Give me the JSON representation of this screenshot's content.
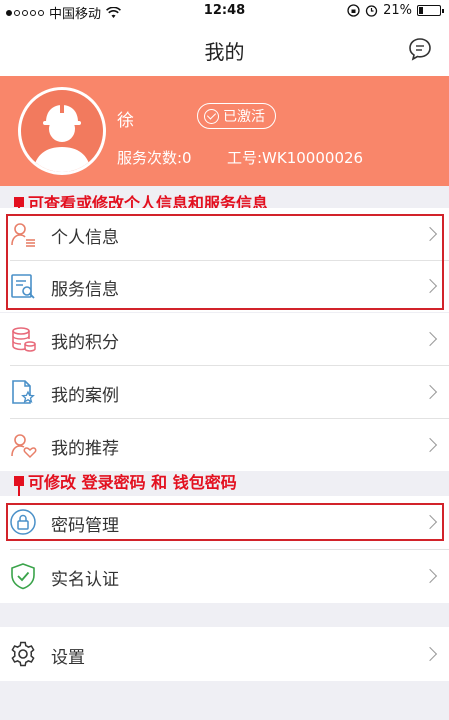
{
  "status_bar": {
    "carrier": "中国移动",
    "time": "12:48",
    "battery": "21%",
    "battery_level": 0.21,
    "signal_bars": 1
  },
  "nav": {
    "title": "我的",
    "message_icon": "message-icon"
  },
  "profile": {
    "name": "徐",
    "status": "已激活",
    "service_count": "服务次数:0",
    "employee_id": "工号:WK10000026"
  },
  "annotations": {
    "info": "可查看或修改个人信息和服务信息",
    "password": "可修改 登录密码 和 钱包密码"
  },
  "menu": {
    "personal_info": "个人信息",
    "service_info": "服务信息",
    "points": "我的积分",
    "cases": "我的案例",
    "referrals": "我的推荐",
    "password_mgmt": "密码管理",
    "real_name": "实名认证",
    "settings": "设置"
  },
  "colors": {
    "header_bg": "#f9866a",
    "annotation_red": "#e3101f",
    "icon_orange": "#e8806a",
    "icon_blue": "#4a90c8",
    "icon_green": "#3aa34a"
  }
}
